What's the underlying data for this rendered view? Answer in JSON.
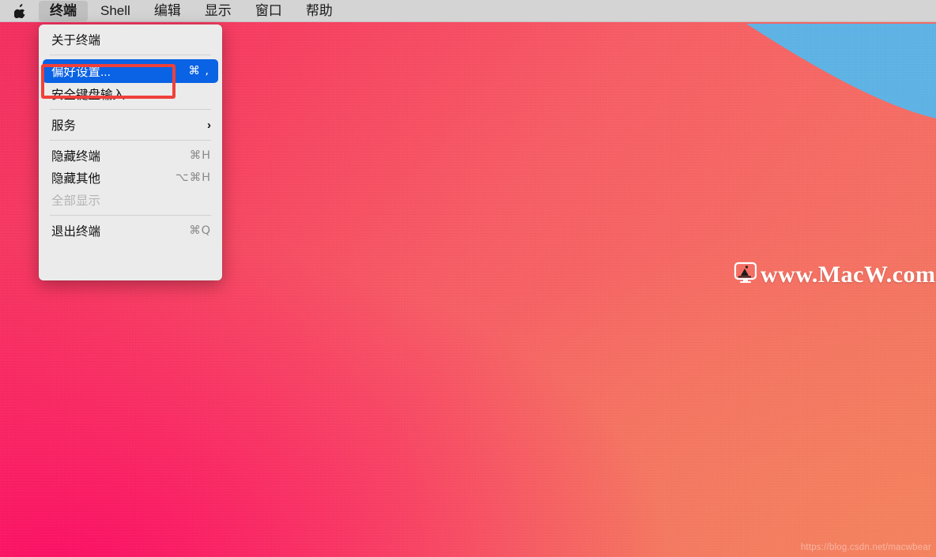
{
  "menubar": {
    "apple_icon": "apple-logo-icon",
    "items": [
      {
        "label": "终端",
        "active": true
      },
      {
        "label": "Shell",
        "active": false
      },
      {
        "label": "编辑",
        "active": false
      },
      {
        "label": "显示",
        "active": false
      },
      {
        "label": "窗口",
        "active": false
      },
      {
        "label": "帮助",
        "active": false
      }
    ]
  },
  "menu": {
    "title": "终端",
    "items": [
      {
        "label": "关于终端",
        "shortcut": "",
        "state": "normal"
      },
      {
        "label": "偏好设置...",
        "shortcut": "⌘ ,",
        "state": "selected"
      },
      {
        "label": "安全键盘输入",
        "shortcut": "",
        "state": "normal"
      },
      {
        "label": "服务",
        "shortcut": "",
        "state": "submenu",
        "chevron": "›"
      },
      {
        "label": "隐藏终端",
        "shortcut": "⌘H",
        "state": "normal"
      },
      {
        "label": "隐藏其他",
        "shortcut": "⌥⌘H",
        "state": "normal"
      },
      {
        "label": "全部显示",
        "shortcut": "",
        "state": "disabled"
      },
      {
        "label": "退出终端",
        "shortcut": "⌘Q",
        "state": "normal"
      }
    ]
  },
  "annotation": {
    "name": "highlight-rectangle",
    "color": "#f0403a",
    "targets": "偏好设置..."
  },
  "watermark": {
    "text": "www.MacW.com",
    "icon": "monitor-icon",
    "color": "#ffffff"
  },
  "footer": {
    "url": "https://blog.csdn.net/macwbear"
  },
  "wallpaper": {
    "name": "big-sur-pink-blue",
    "pink_top": "#f62a5e",
    "pink_bottom_left": "#ff0a63",
    "coral_bottom_right": "#f5775f",
    "blue_accent": "#5bb4e7"
  }
}
